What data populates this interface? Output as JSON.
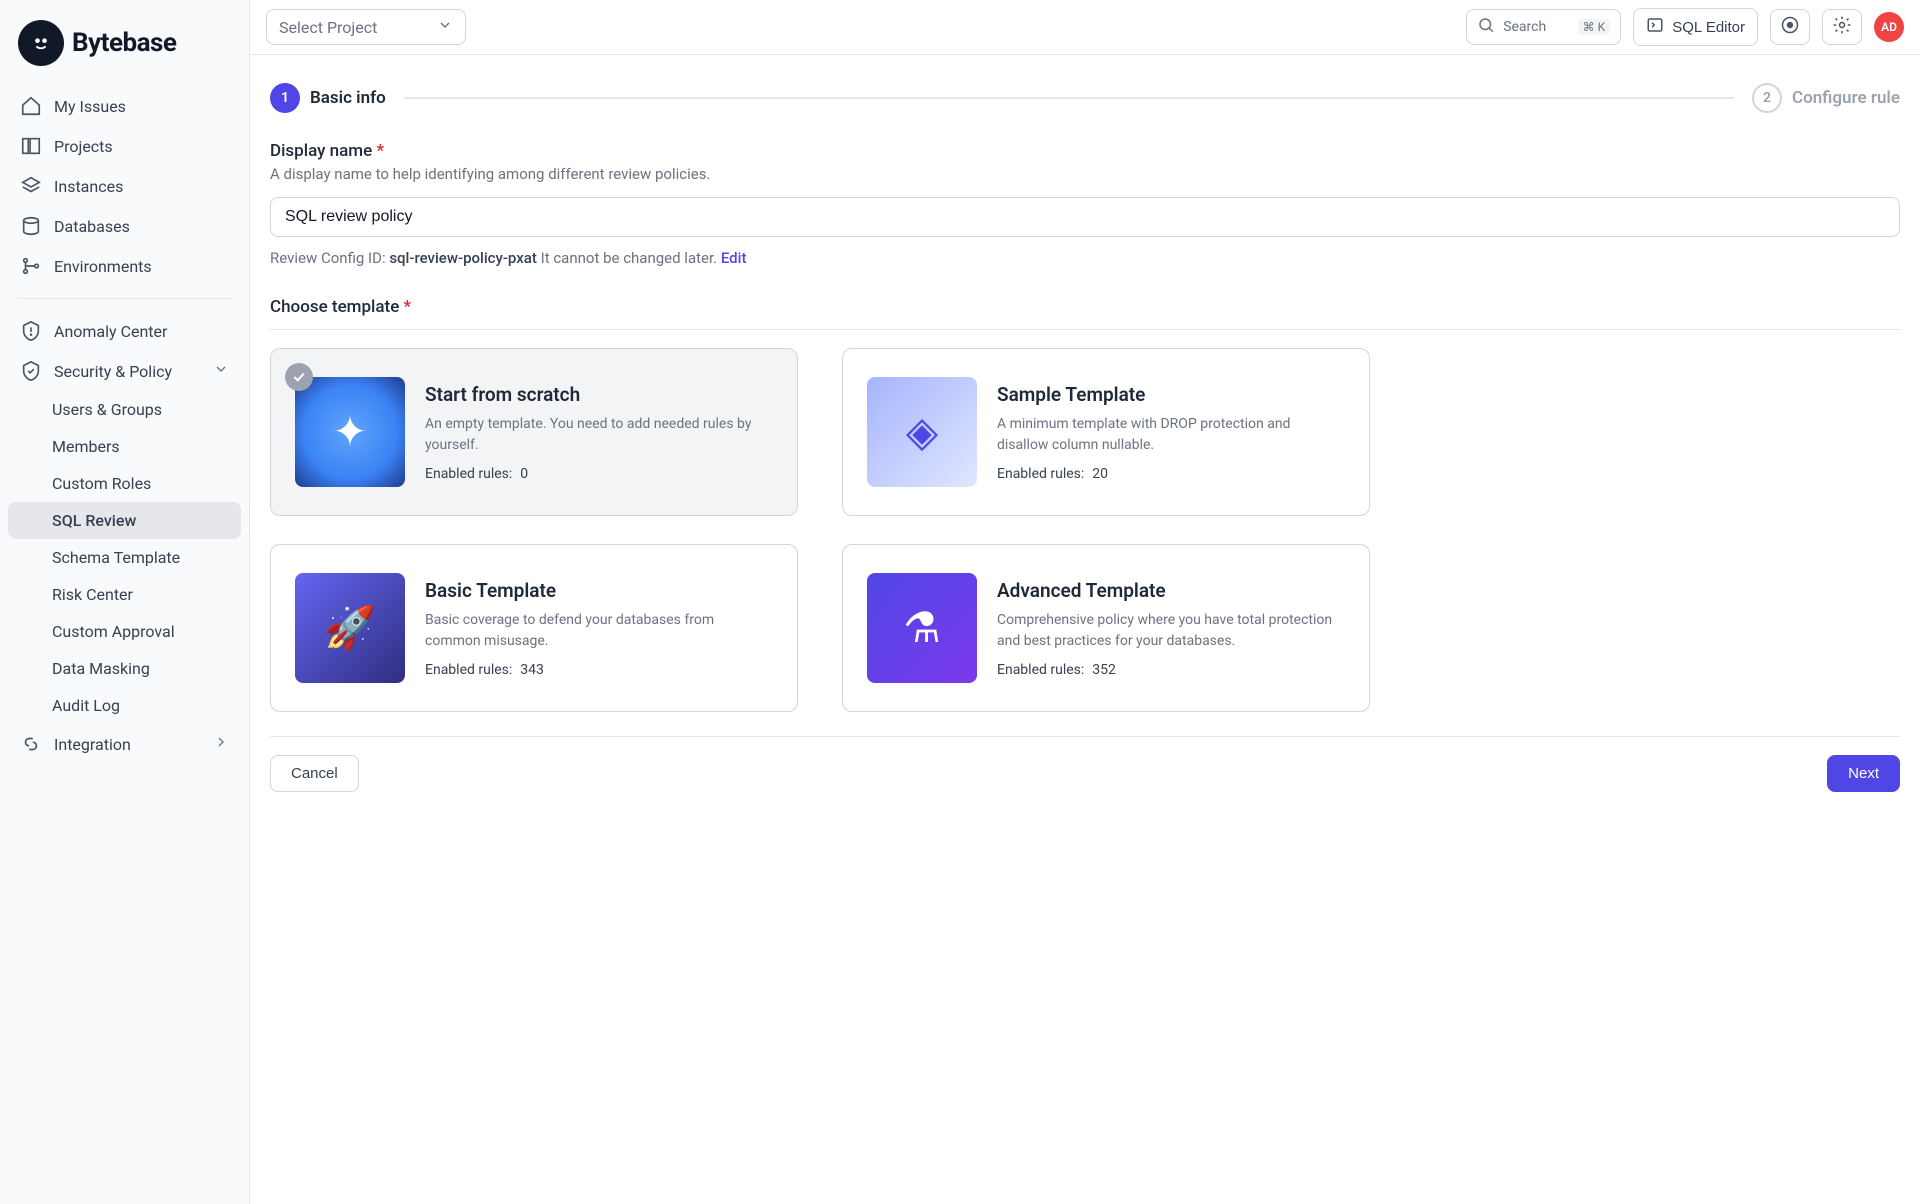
{
  "brand": {
    "name": "Bytebase"
  },
  "sidebar": {
    "items": [
      {
        "label": "My Issues"
      },
      {
        "label": "Projects"
      },
      {
        "label": "Instances"
      },
      {
        "label": "Databases"
      },
      {
        "label": "Environments"
      }
    ],
    "secondary": [
      {
        "label": "Anomaly Center"
      },
      {
        "label": "Security & Policy",
        "expanded": true,
        "children": [
          {
            "label": "Users & Groups"
          },
          {
            "label": "Members"
          },
          {
            "label": "Custom Roles"
          },
          {
            "label": "SQL Review",
            "active": true
          },
          {
            "label": "Schema Template"
          },
          {
            "label": "Risk Center"
          },
          {
            "label": "Custom Approval"
          },
          {
            "label": "Data Masking"
          },
          {
            "label": "Audit Log"
          }
        ]
      },
      {
        "label": "Integration"
      }
    ]
  },
  "topbar": {
    "project_selector": "Select Project",
    "search_placeholder": "Search",
    "search_shortcut": "⌘ K",
    "sql_editor": "SQL Editor",
    "avatar_initials": "AD"
  },
  "steps": {
    "step1_num": "1",
    "step1_label": "Basic info",
    "step2_num": "2",
    "step2_label": "Configure rule"
  },
  "form": {
    "display_name_label": "Display name",
    "display_name_hint": "A display name to help identifying among different review policies.",
    "display_name_value": "SQL review policy",
    "review_id_prefix": "Review Config ID:",
    "review_id": "sql-review-policy-pxat",
    "review_id_suffix": "It cannot be changed later.",
    "edit_label": "Edit",
    "choose_template_label": "Choose template"
  },
  "templates": [
    {
      "title": "Start from scratch",
      "desc": "An empty template. You need to add needed rules by yourself.",
      "rules_label": "Enabled rules:",
      "rules": "0",
      "selected": true
    },
    {
      "title": "Sample Template",
      "desc": "A minimum template with DROP protection and disallow column nullable.",
      "rules_label": "Enabled rules:",
      "rules": "20"
    },
    {
      "title": "Basic Template",
      "desc": "Basic coverage to defend your databases from common misusage.",
      "rules_label": "Enabled rules:",
      "rules": "343"
    },
    {
      "title": "Advanced Template",
      "desc": "Comprehensive policy where you have total protection and best practices for your databases.",
      "rules_label": "Enabled rules:",
      "rules": "352"
    }
  ],
  "footer": {
    "cancel": "Cancel",
    "next": "Next"
  }
}
